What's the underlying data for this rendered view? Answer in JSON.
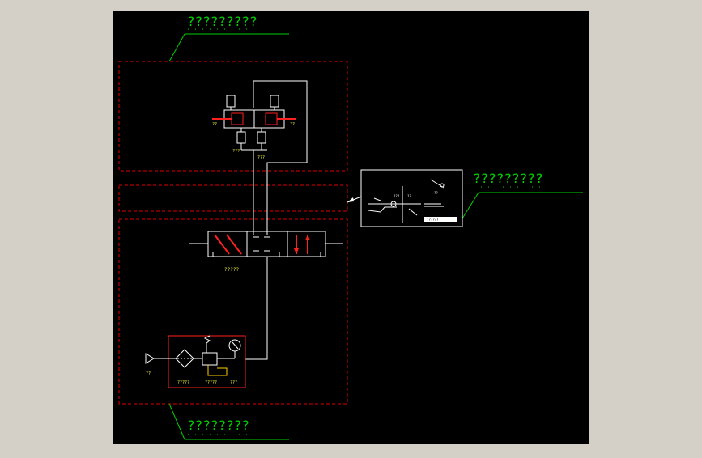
{
  "window": {
    "background": "#d4d0c8"
  },
  "drawing": {
    "background": "#000000",
    "colors": {
      "line": "#ffffff",
      "boundary": "#e00000",
      "component": "#ff2020",
      "annotation": "#00d000",
      "text_small": "#ffff40"
    },
    "callouts": {
      "top": "?????????",
      "right": "?????????",
      "bottom": "????????"
    },
    "labels": {
      "cyl_left_port": "??",
      "cyl_right_port": "??",
      "cyl_mid_left": "???",
      "cyl_mid_right": "???",
      "valve_name": "?????",
      "source": "??",
      "frl_name": "?????",
      "regulator": "?????",
      "gauge": "???"
    },
    "detail_view": {
      "title": "??????",
      "items": [
        "???",
        "??",
        "??"
      ]
    }
  }
}
